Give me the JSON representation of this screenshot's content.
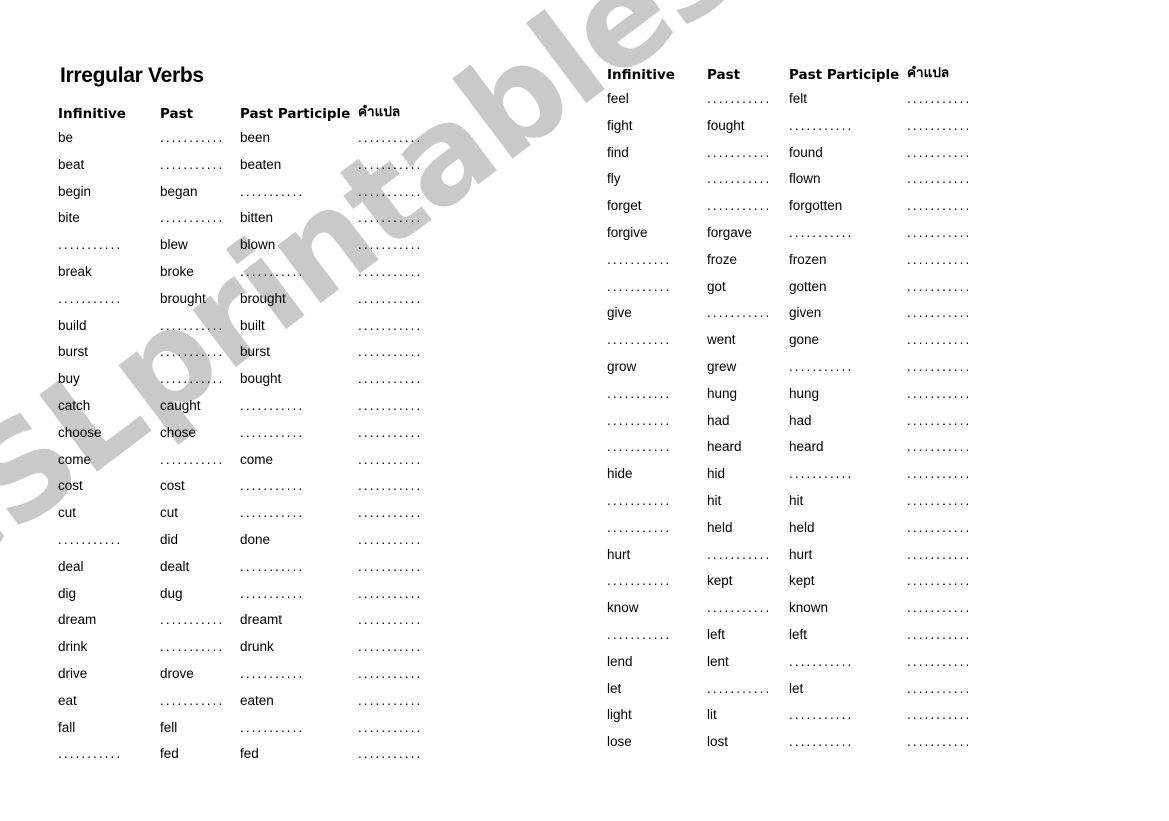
{
  "title": "Irregular Verbs",
  "watermark": "eSLprintables.com",
  "blank": "...........",
  "headers": {
    "infinitive": "Infinitive",
    "past": "Past",
    "past_participle": "Past Participle",
    "translation": "คำแปล"
  },
  "left_table": [
    {
      "infinitive": "be",
      "past": "",
      "past_participle": "been",
      "translation": ""
    },
    {
      "infinitive": "beat",
      "past": "",
      "past_participle": "beaten",
      "translation": ""
    },
    {
      "infinitive": "begin",
      "past": "began",
      "past_participle": "",
      "translation": ""
    },
    {
      "infinitive": "bite",
      "past": "",
      "past_participle": "bitten",
      "translation": ""
    },
    {
      "infinitive": "",
      "past": "blew",
      "past_participle": "blown",
      "translation": ""
    },
    {
      "infinitive": "break",
      "past": "broke",
      "past_participle": "",
      "translation": ""
    },
    {
      "infinitive": "",
      "past": "brought",
      "past_participle": "brought",
      "translation": ""
    },
    {
      "infinitive": "build",
      "past": "",
      "past_participle": "built",
      "translation": ""
    },
    {
      "infinitive": "burst",
      "past": "",
      "past_participle": "burst",
      "translation": ""
    },
    {
      "infinitive": "buy",
      "past": "",
      "past_participle": "bought",
      "translation": ""
    },
    {
      "infinitive": "catch",
      "past": "caught",
      "past_participle": "",
      "translation": ""
    },
    {
      "infinitive": "choose",
      "past": "chose",
      "past_participle": "",
      "translation": ""
    },
    {
      "infinitive": "come",
      "past": "",
      "past_participle": "come",
      "translation": ""
    },
    {
      "infinitive": "cost",
      "past": "cost",
      "past_participle": "",
      "translation": ""
    },
    {
      "infinitive": "cut",
      "past": "cut",
      "past_participle": "",
      "translation": ""
    },
    {
      "infinitive": "",
      "past": "did",
      "past_participle": "done",
      "translation": ""
    },
    {
      "infinitive": "deal",
      "past": "dealt",
      "past_participle": "",
      "translation": ""
    },
    {
      "infinitive": "dig",
      "past": "dug",
      "past_participle": "",
      "translation": ""
    },
    {
      "infinitive": "dream",
      "past": "",
      "past_participle": "dreamt",
      "translation": ""
    },
    {
      "infinitive": "drink",
      "past": "",
      "past_participle": "drunk",
      "translation": ""
    },
    {
      "infinitive": "drive",
      "past": "drove",
      "past_participle": "",
      "translation": ""
    },
    {
      "infinitive": "eat",
      "past": "",
      "past_participle": "eaten",
      "translation": ""
    },
    {
      "infinitive": "fall",
      "past": "fell",
      "past_participle": "",
      "translation": ""
    },
    {
      "infinitive": "",
      "past": "fed",
      "past_participle": "fed",
      "translation": ""
    }
  ],
  "right_table": [
    {
      "infinitive": "feel",
      "past": "",
      "past_participle": "felt",
      "translation": ""
    },
    {
      "infinitive": "fight",
      "past": "fought",
      "past_participle": "",
      "translation": ""
    },
    {
      "infinitive": "find",
      "past": "",
      "past_participle": "found",
      "translation": ""
    },
    {
      "infinitive": "fly",
      "past": "",
      "past_participle": "flown",
      "translation": ""
    },
    {
      "infinitive": "forget",
      "past": "",
      "past_participle": "forgotten",
      "translation": ""
    },
    {
      "infinitive": "forgive",
      "past": "forgave",
      "past_participle": "",
      "translation": ""
    },
    {
      "infinitive": "",
      "past": "froze",
      "past_participle": "frozen",
      "translation": ""
    },
    {
      "infinitive": "",
      "past": "got",
      "past_participle": "gotten",
      "translation": ""
    },
    {
      "infinitive": "give",
      "past": "",
      "past_participle": "given",
      "translation": ""
    },
    {
      "infinitive": "",
      "past": "went",
      "past_participle": "gone",
      "translation": ""
    },
    {
      "infinitive": "grow",
      "past": "grew",
      "past_participle": "",
      "translation": ""
    },
    {
      "infinitive": "",
      "past": "hung",
      "past_participle": "hung",
      "translation": ""
    },
    {
      "infinitive": "",
      "past": "had",
      "past_participle": "had",
      "translation": ""
    },
    {
      "infinitive": "",
      "past": "heard",
      "past_participle": "heard",
      "translation": ""
    },
    {
      "infinitive": "hide",
      "past": "hid",
      "past_participle": "",
      "translation": ""
    },
    {
      "infinitive": "",
      "past": "hit",
      "past_participle": "hit",
      "translation": ""
    },
    {
      "infinitive": "",
      "past": "held",
      "past_participle": "held",
      "translation": ""
    },
    {
      "infinitive": "hurt",
      "past": "",
      "past_participle": "hurt",
      "translation": ""
    },
    {
      "infinitive": "",
      "past": "kept",
      "past_participle": "kept",
      "translation": ""
    },
    {
      "infinitive": "know",
      "past": "",
      "past_participle": "known",
      "translation": ""
    },
    {
      "infinitive": "",
      "past": "left",
      "past_participle": "left",
      "translation": ""
    },
    {
      "infinitive": "lend",
      "past": "lent",
      "past_participle": "",
      "translation": ""
    },
    {
      "infinitive": "let",
      "past": "",
      "past_participle": "let",
      "translation": ""
    },
    {
      "infinitive": "light",
      "past": "lit",
      "past_participle": "",
      "translation": ""
    },
    {
      "infinitive": "lose",
      "past": "lost",
      "past_participle": "",
      "translation": ""
    }
  ]
}
